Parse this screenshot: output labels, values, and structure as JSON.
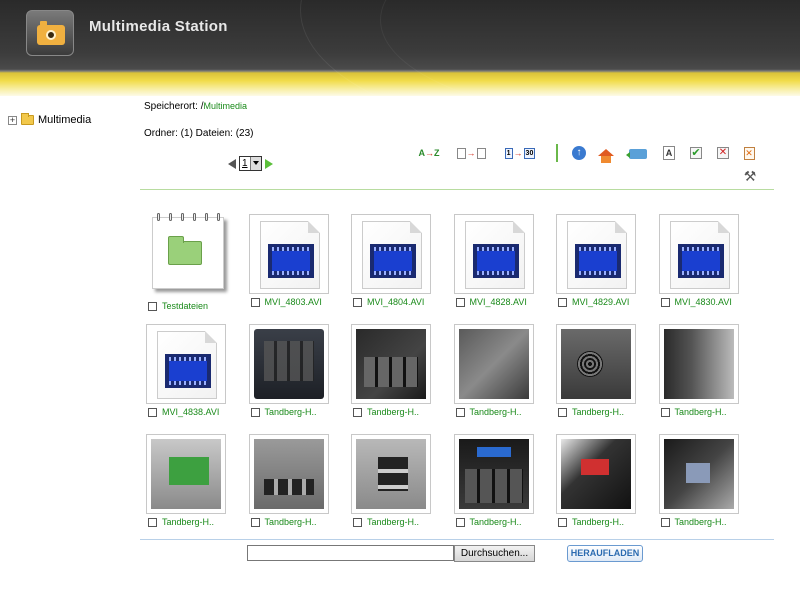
{
  "app": {
    "title": "Multimedia Station"
  },
  "sidebar": {
    "tree": [
      {
        "label": "Multimedia",
        "expander": "+"
      }
    ]
  },
  "path": {
    "label": "Speicherort: /",
    "link": "Multimedia"
  },
  "counts": {
    "text": "Ordner: (1) Dateien: (23)"
  },
  "pager": {
    "current": "1"
  },
  "toolbar": {
    "sort_az": {
      "a": "A",
      "z": "Z"
    },
    "cal_from": "1",
    "cal_to": "30",
    "rename_letter": "A",
    "check_mark": "✔",
    "uncheck_mark": "✕",
    "delete_mark": "✕",
    "tools_glyph": "⚒"
  },
  "grid": {
    "items": [
      {
        "name": "Testdateien",
        "kind": "folder"
      },
      {
        "name": "MVI_4803.AVI",
        "kind": "video"
      },
      {
        "name": "MVI_4804.AVI",
        "kind": "video"
      },
      {
        "name": "MVI_4828.AVI",
        "kind": "video"
      },
      {
        "name": "MVI_4829.AVI",
        "kind": "video"
      },
      {
        "name": "MVI_4830.AVI",
        "kind": "video"
      },
      {
        "name": "MVI_4838.AVI",
        "kind": "video"
      },
      {
        "name": "Tandberg-H..",
        "kind": "photo",
        "style": "p-nas8"
      },
      {
        "name": "Tandberg-H..",
        "kind": "photo",
        "style": "p-nas4"
      },
      {
        "name": "Tandberg-H..",
        "kind": "photo",
        "style": "p-nas2"
      },
      {
        "name": "Tandberg-H..",
        "kind": "photo",
        "style": "p-back"
      },
      {
        "name": "Tandberg-H..",
        "kind": "photo",
        "style": "p-trays"
      },
      {
        "name": "Tandberg-H..",
        "kind": "photo",
        "style": "p-hdd"
      },
      {
        "name": "Tandberg-H..",
        "kind": "photo",
        "style": "p-ports"
      },
      {
        "name": "Tandberg-H..",
        "kind": "photo",
        "style": "p-usb"
      },
      {
        "name": "Tandberg-H..",
        "kind": "photo",
        "style": "p-front"
      },
      {
        "name": "Tandberg-H..",
        "kind": "photo",
        "style": "p-open1"
      },
      {
        "name": "Tandberg-H..",
        "kind": "photo",
        "style": "p-open2"
      }
    ]
  },
  "upload": {
    "file_value": "",
    "browse_label": "Durchsuchen...",
    "upload_label": "HERAUFLADEN"
  },
  "colors": {
    "link_green": "#1a8a1a",
    "header_dark": "#2a2a2a",
    "accent_yellow": "#f1dc4a",
    "upload_blue": "#2a6ab0"
  }
}
